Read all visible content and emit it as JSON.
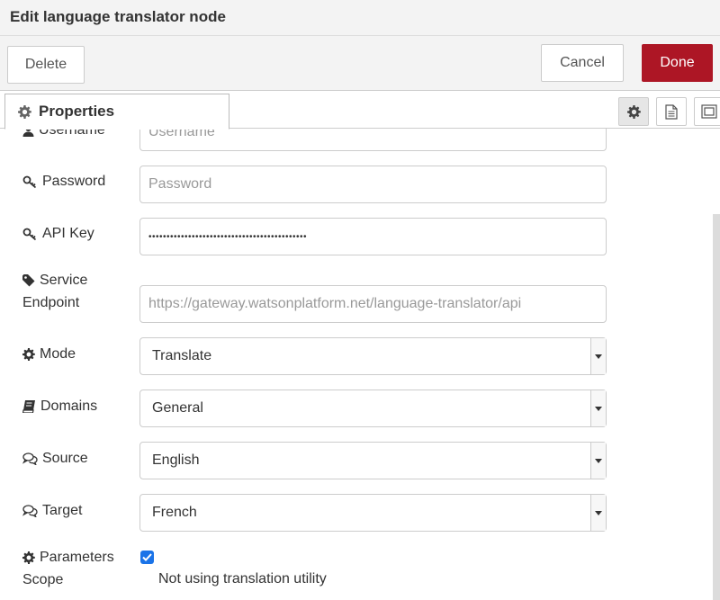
{
  "window": {
    "title": "Edit language translator node"
  },
  "toolbar": {
    "delete_label": "Delete",
    "cancel_label": "Cancel",
    "done_label": "Done",
    "done_color": "#ad1625"
  },
  "tabs": {
    "properties_label": "Properties"
  },
  "fields": {
    "username": {
      "label": "Username",
      "placeholder": "Username"
    },
    "password": {
      "label": "Password",
      "placeholder": "Password"
    },
    "apikey": {
      "label": "API Key",
      "value": "••••••••••••••••••••••••••••••••••••••••••••"
    },
    "endpoint": {
      "label_line1": "Service",
      "label_line2": "Endpoint",
      "placeholder": "https://gateway.watsonplatform.net/language-translator/api"
    },
    "mode": {
      "label": "Mode",
      "value": "Translate"
    },
    "domains": {
      "label": "Domains",
      "value": "General"
    },
    "source": {
      "label": "Source",
      "value": "English"
    },
    "target": {
      "label": "Target",
      "value": "French"
    },
    "params": {
      "label_line1": "Parameters",
      "label_line2": "Scope",
      "checked": true,
      "note": "Not using translation utility"
    }
  },
  "icons": [
    "user-icon",
    "key-icon",
    "tag-icon",
    "gear-icon",
    "book-icon",
    "comments-icon",
    "file-icon",
    "frame-icon"
  ]
}
